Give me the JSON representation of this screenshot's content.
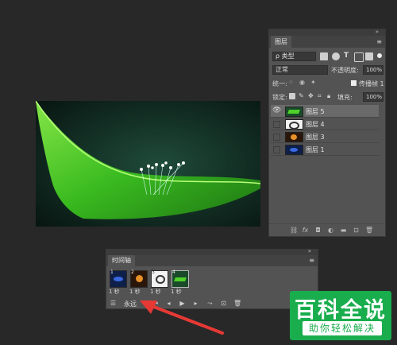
{
  "layers_panel": {
    "tab": "图层",
    "filter_label": "ρ 类型",
    "blend_mode": "正常",
    "opacity_label": "不透明度:",
    "opacity_value": "100%",
    "unify_label": "统一:",
    "propagate_label": "传播帧 1",
    "lock_label": "锁定:",
    "fill_label": "填充:",
    "fill_value": "100%",
    "layers": [
      {
        "name": "图层 5",
        "visible": true,
        "selected": true
      },
      {
        "name": "图层 4",
        "visible": false,
        "selected": false
      },
      {
        "name": "图层 3",
        "visible": false,
        "selected": false
      },
      {
        "name": "图层 1",
        "visible": false,
        "selected": false
      }
    ]
  },
  "timeline": {
    "tab": "时间轴",
    "frames": [
      {
        "number": "1",
        "delay": "1 秒"
      },
      {
        "number": "2",
        "delay": "1 秒"
      },
      {
        "number": "3",
        "delay": "1 秒"
      },
      {
        "number": "4",
        "delay": "1 秒"
      }
    ],
    "loop_label": "永远"
  },
  "watermark": {
    "title": "百科全说",
    "subtitle": "助你轻松解决"
  },
  "colors": {
    "background": "#282828",
    "panel": "#535353",
    "selected_layer": "#6a6a6a",
    "arrow": "#e53935",
    "watermark": "#19ad4d"
  }
}
